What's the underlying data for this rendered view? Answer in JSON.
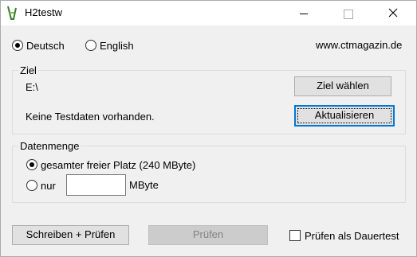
{
  "window": {
    "title": "H2testw",
    "app_icon": "h2testw-app-icon"
  },
  "language": {
    "options": [
      {
        "label": "Deutsch",
        "checked": true
      },
      {
        "label": "English",
        "checked": false
      }
    ],
    "website": "www.ctmagazin.de"
  },
  "ziel": {
    "title": "Ziel",
    "path": "E:\\",
    "status": "Keine Testdaten vorhanden.",
    "choose_button": "Ziel wählen",
    "refresh_button": "Aktualisieren"
  },
  "datenmenge": {
    "title": "Datenmenge",
    "option_all": "gesamter freier Platz (240 MByte)",
    "option_all_checked": true,
    "option_only": "nur",
    "option_only_checked": false,
    "amount_value": "",
    "unit": "MByte"
  },
  "actions": {
    "write_verify": "Schreiben + Prüfen",
    "verify": "Prüfen",
    "verify_disabled": true,
    "endurance_label": "Prüfen als Dauertest",
    "endurance_checked": false
  }
}
